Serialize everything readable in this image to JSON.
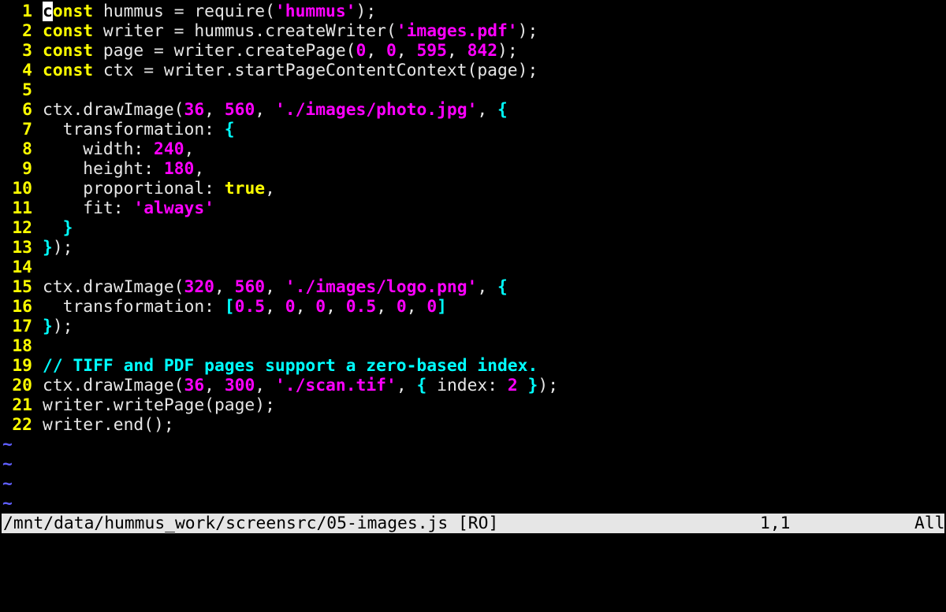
{
  "editor": {
    "lines": [
      {
        "num": "1",
        "tokens": [
          [
            "k",
            "c",
            true
          ],
          [
            "k",
            "onst"
          ],
          [
            "t",
            " hummus = require("
          ],
          [
            "s",
            "'hummus'"
          ],
          [
            "t",
            ");"
          ]
        ]
      },
      {
        "num": "2",
        "tokens": [
          [
            "k",
            "const"
          ],
          [
            "t",
            " writer = hummus.createWriter("
          ],
          [
            "s",
            "'images.pdf'"
          ],
          [
            "t",
            ");"
          ]
        ]
      },
      {
        "num": "3",
        "tokens": [
          [
            "k",
            "const"
          ],
          [
            "t",
            " page = writer.createPage("
          ],
          [
            "n",
            "0"
          ],
          [
            "t",
            ", "
          ],
          [
            "n",
            "0"
          ],
          [
            "t",
            ", "
          ],
          [
            "n",
            "595"
          ],
          [
            "t",
            ", "
          ],
          [
            "n",
            "842"
          ],
          [
            "t",
            ");"
          ]
        ]
      },
      {
        "num": "4",
        "tokens": [
          [
            "k",
            "const"
          ],
          [
            "t",
            " ctx = writer.startPageContentContext(page);"
          ]
        ]
      },
      {
        "num": "5",
        "tokens": []
      },
      {
        "num": "6",
        "tokens": [
          [
            "t",
            "ctx.drawImage("
          ],
          [
            "n",
            "36"
          ],
          [
            "t",
            ", "
          ],
          [
            "n",
            "560"
          ],
          [
            "t",
            ", "
          ],
          [
            "s",
            "'./images/photo.jpg'"
          ],
          [
            "t",
            ", "
          ],
          [
            "b",
            "{"
          ]
        ]
      },
      {
        "num": "7",
        "tokens": [
          [
            "t",
            "  transformation: "
          ],
          [
            "b",
            "{"
          ]
        ]
      },
      {
        "num": "8",
        "tokens": [
          [
            "t",
            "    width: "
          ],
          [
            "n",
            "240"
          ],
          [
            "t",
            ","
          ]
        ]
      },
      {
        "num": "9",
        "tokens": [
          [
            "t",
            "    height: "
          ],
          [
            "n",
            "180"
          ],
          [
            "t",
            ","
          ]
        ]
      },
      {
        "num": "10",
        "tokens": [
          [
            "t",
            "    proportional: "
          ],
          [
            "k",
            "true"
          ],
          [
            "t",
            ","
          ]
        ]
      },
      {
        "num": "11",
        "tokens": [
          [
            "t",
            "    fit: "
          ],
          [
            "s",
            "'always'"
          ]
        ]
      },
      {
        "num": "12",
        "tokens": [
          [
            "t",
            "  "
          ],
          [
            "b",
            "}"
          ]
        ]
      },
      {
        "num": "13",
        "tokens": [
          [
            "b",
            "}"
          ],
          [
            "t",
            ");"
          ]
        ]
      },
      {
        "num": "14",
        "tokens": []
      },
      {
        "num": "15",
        "tokens": [
          [
            "t",
            "ctx.drawImage("
          ],
          [
            "n",
            "320"
          ],
          [
            "t",
            ", "
          ],
          [
            "n",
            "560"
          ],
          [
            "t",
            ", "
          ],
          [
            "s",
            "'./images/logo.png'"
          ],
          [
            "t",
            ", "
          ],
          [
            "b",
            "{"
          ]
        ]
      },
      {
        "num": "16",
        "tokens": [
          [
            "t",
            "  transformation: "
          ],
          [
            "b",
            "["
          ],
          [
            "n",
            "0.5"
          ],
          [
            "t",
            ", "
          ],
          [
            "n",
            "0"
          ],
          [
            "t",
            ", "
          ],
          [
            "n",
            "0"
          ],
          [
            "t",
            ", "
          ],
          [
            "n",
            "0.5"
          ],
          [
            "t",
            ", "
          ],
          [
            "n",
            "0"
          ],
          [
            "t",
            ", "
          ],
          [
            "n",
            "0"
          ],
          [
            "b",
            "]"
          ]
        ]
      },
      {
        "num": "17",
        "tokens": [
          [
            "b",
            "}"
          ],
          [
            "t",
            ");"
          ]
        ]
      },
      {
        "num": "18",
        "tokens": []
      },
      {
        "num": "19",
        "tokens": [
          [
            "c",
            "// TIFF and PDF pages support a zero-based index."
          ]
        ]
      },
      {
        "num": "20",
        "tokens": [
          [
            "t",
            "ctx.drawImage("
          ],
          [
            "n",
            "36"
          ],
          [
            "t",
            ", "
          ],
          [
            "n",
            "300"
          ],
          [
            "t",
            ", "
          ],
          [
            "s",
            "'./scan.tif'"
          ],
          [
            "t",
            ", "
          ],
          [
            "b",
            "{"
          ],
          [
            "t",
            " index: "
          ],
          [
            "n",
            "2"
          ],
          [
            "t",
            " "
          ],
          [
            "b",
            "}"
          ],
          [
            "t",
            ");"
          ]
        ]
      },
      {
        "num": "21",
        "tokens": [
          [
            "t",
            "writer.writePage(page);"
          ]
        ]
      },
      {
        "num": "22",
        "tokens": [
          [
            "t",
            "writer.end();"
          ]
        ]
      }
    ],
    "tilde_char": "~",
    "tilde_count": 4
  },
  "statusline": {
    "file": "/mnt/data/hummus_work/screensrc/05-images.js [RO]",
    "position": "1,1",
    "scroll": "All"
  },
  "colors": {
    "background": "#000000",
    "keyword": "#ffff00",
    "string": "#ff00ff",
    "number": "#ff00ff",
    "brace": "#00ffff",
    "comment": "#00ffff",
    "text": "#e6e6e6",
    "tilde": "#5f5fff",
    "statusline_bg": "#e6e6e6"
  }
}
